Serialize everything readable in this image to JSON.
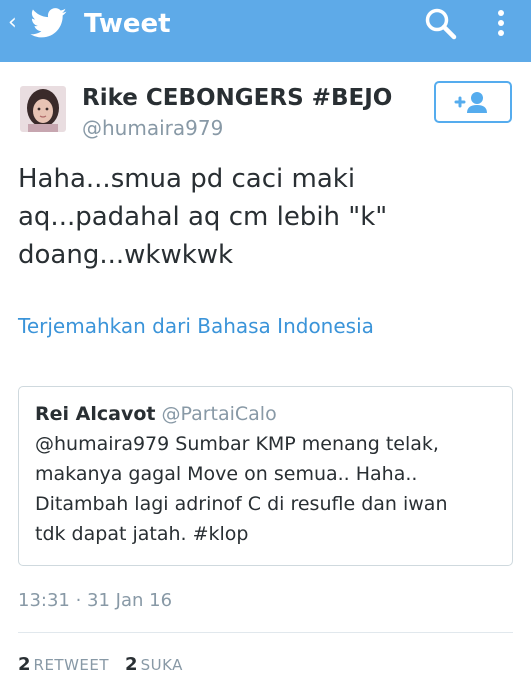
{
  "header": {
    "title": "Tweet",
    "bar_color": "#5eaae8",
    "icons": [
      "chevron-left-icon",
      "twitter-bird-icon",
      "search-icon",
      "more-vertical-icon"
    ]
  },
  "author": {
    "display_name": "Rike CEBONGERS #BEJO",
    "handle": "@humaira979",
    "follow_icon": "add-user-icon"
  },
  "tweet": {
    "lines": [
      "Haha...smua pd caci maki",
      "aq...padahal aq cm lebih \"k\"",
      "doang...wkwkwk"
    ],
    "translate_label": "Terjemahkan dari Bahasa Indonesia"
  },
  "quote": {
    "name": "Rei Alcavot",
    "handle": "@PartaiCalo",
    "lines": [
      "@humaira979 Sumbar KMP menang telak,",
      "makanya gagal Move on semua.. Haha..",
      "Ditambah lagi adrinof C di resufle dan iwan",
      "tdk dapat jatah. #klop"
    ]
  },
  "meta": {
    "timestamp": "13:31 · 31 Jan 16"
  },
  "stats": {
    "retweets": "2",
    "retweet_label": "RETWEET",
    "likes": "2",
    "like_label": "SUKA"
  },
  "colors": {
    "accent": "#55acee",
    "link": "#3b94d9",
    "muted": "#8899a6",
    "text": "#292f33"
  }
}
